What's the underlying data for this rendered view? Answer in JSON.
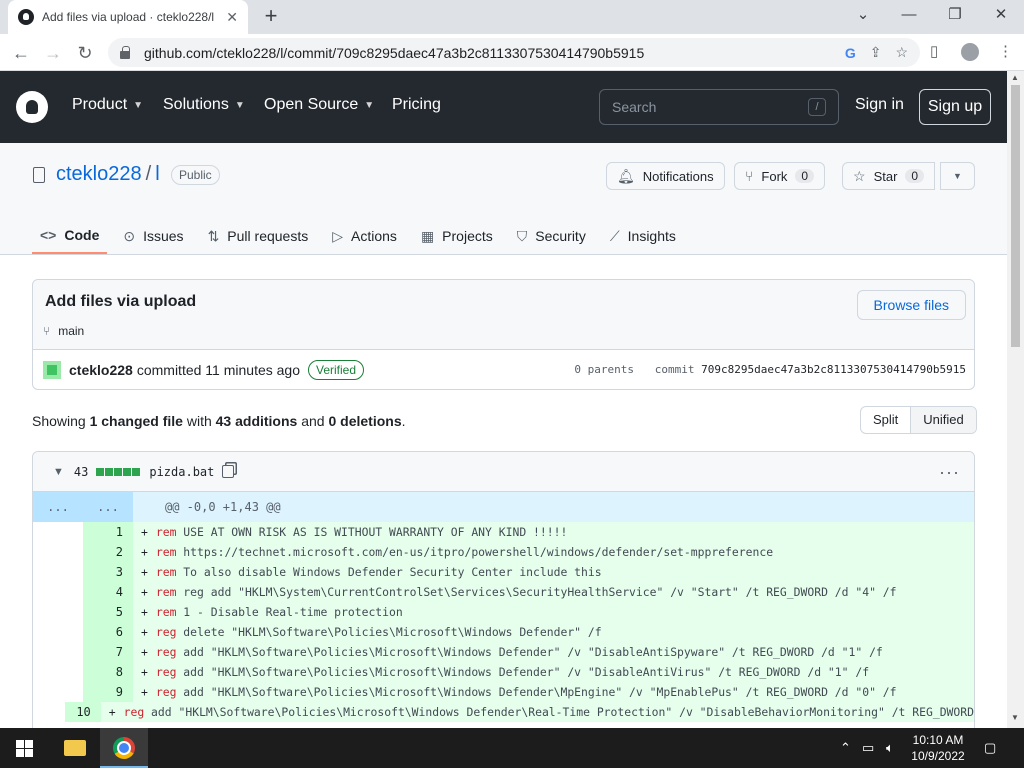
{
  "browser": {
    "tab_title": "Add files via upload · cteklo228/l",
    "url": "github.com/cteklo228/l/commit/709c8295daec47a3b2c8113307530414790b5915"
  },
  "header": {
    "nav": [
      "Product",
      "Solutions",
      "Open Source",
      "Pricing"
    ],
    "search_placeholder": "Search",
    "search_key": "/",
    "sign_in": "Sign in",
    "sign_up": "Sign up"
  },
  "repo": {
    "owner": "cteklo228",
    "separator": "/",
    "name": "l",
    "visibility": "Public",
    "notifications": "Notifications",
    "fork_label": "Fork",
    "fork_count": "0",
    "star_label": "Star",
    "star_count": "0",
    "tabs": [
      "Code",
      "Issues",
      "Pull requests",
      "Actions",
      "Projects",
      "Security",
      "Insights"
    ]
  },
  "commit": {
    "title": "Add files via upload",
    "branch": "main",
    "browse_files": "Browse files",
    "author": "cteklo228",
    "action": "committed",
    "time": "11 minutes ago",
    "verified": "Verified",
    "parents": "0 parents",
    "sha_label": "commit",
    "sha": "709c8295daec47a3b2c8113307530414790b5915"
  },
  "summary": {
    "showing": "Showing",
    "changed": "1 changed file",
    "with": "with",
    "additions": "43 additions",
    "and": "and",
    "deletions": "0 deletions",
    "split": "Split",
    "unified": "Unified"
  },
  "file": {
    "count": "43",
    "name": "pizda.bat",
    "hunk_left": "...",
    "hunk_right": "...",
    "hunk_header": "@@ -0,0 +1,43 @@",
    "lines": [
      {
        "n": "1",
        "kw": "rem",
        "text": " USE AT OWN RISK AS IS WITHOUT WARRANTY OF ANY KIND !!!!!"
      },
      {
        "n": "2",
        "kw": "rem",
        "text": " https://technet.microsoft.com/en-us/itpro/powershell/windows/defender/set-mppreference"
      },
      {
        "n": "3",
        "kw": "rem",
        "text": " To also disable Windows Defender Security Center include this"
      },
      {
        "n": "4",
        "kw": "rem",
        "text": " reg add \"HKLM\\System\\CurrentControlSet\\Services\\SecurityHealthService\" /v \"Start\" /t REG_DWORD /d \"4\" /f"
      },
      {
        "n": "5",
        "kw": "rem",
        "text": " 1 - Disable Real-time protection"
      },
      {
        "n": "6",
        "kw": "reg",
        "text": " delete \"HKLM\\Software\\Policies\\Microsoft\\Windows Defender\" /f"
      },
      {
        "n": "7",
        "kw": "reg",
        "text": " add \"HKLM\\Software\\Policies\\Microsoft\\Windows Defender\" /v \"DisableAntiSpyware\" /t REG_DWORD /d \"1\" /f"
      },
      {
        "n": "8",
        "kw": "reg",
        "text": " add \"HKLM\\Software\\Policies\\Microsoft\\Windows Defender\" /v \"DisableAntiVirus\" /t REG_DWORD /d \"1\" /f"
      },
      {
        "n": "9",
        "kw": "reg",
        "text": " add \"HKLM\\Software\\Policies\\Microsoft\\Windows Defender\\MpEngine\" /v \"MpEnablePus\" /t REG_DWORD /d \"0\" /f"
      },
      {
        "n": "10",
        "kw": "reg",
        "text": " add \"HKLM\\Software\\Policies\\Microsoft\\Windows Defender\\Real-Time Protection\" /v \"DisableBehaviorMonitoring\" /t REG_DWORD"
      }
    ]
  },
  "taskbar": {
    "time": "10:10 AM",
    "date": "10/9/2022"
  },
  "colors": {
    "header_bg": "#24292f",
    "link": "#0969da",
    "addition_bg": "#e6ffec",
    "verified": "#1a7f37",
    "active_tab": "#fd8c73"
  }
}
